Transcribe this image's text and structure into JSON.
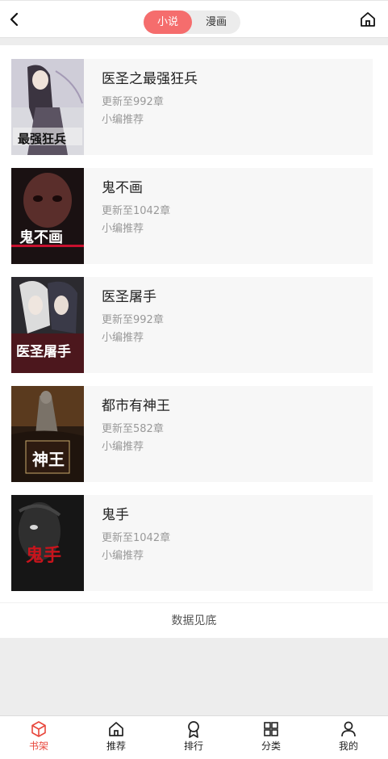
{
  "header": {
    "tabs": [
      {
        "label": "小说",
        "active": true
      },
      {
        "label": "漫画",
        "active": false
      }
    ]
  },
  "books": [
    {
      "title": "医圣之最强狂兵",
      "update": "更新至992章",
      "tag": "小编推荐",
      "cover_text": "最强狂兵"
    },
    {
      "title": "鬼不画",
      "update": "更新至1042章",
      "tag": "小编推荐",
      "cover_text": "鬼不画"
    },
    {
      "title": "医圣屠手",
      "update": "更新至992章",
      "tag": "小编推荐",
      "cover_text": "医圣屠手"
    },
    {
      "title": "都市有神王",
      "update": "更新至582章",
      "tag": "小编推荐",
      "cover_text": "神王"
    },
    {
      "title": "鬼手",
      "update": "更新至1042章",
      "tag": "小编推荐",
      "cover_text": "鬼手"
    }
  ],
  "footer_note": "数据见底",
  "tabbar": {
    "items": [
      {
        "label": "书架",
        "icon": "cube-icon",
        "active": true
      },
      {
        "label": "推荐",
        "icon": "home-icon",
        "active": false
      },
      {
        "label": "排行",
        "icon": "award-icon",
        "active": false
      },
      {
        "label": "分类",
        "icon": "grid-icon",
        "active": false
      },
      {
        "label": "我的",
        "icon": "user-icon",
        "active": false
      }
    ],
    "active_color": "#e8473c"
  },
  "colors": {
    "accent": "#f56d6d"
  }
}
